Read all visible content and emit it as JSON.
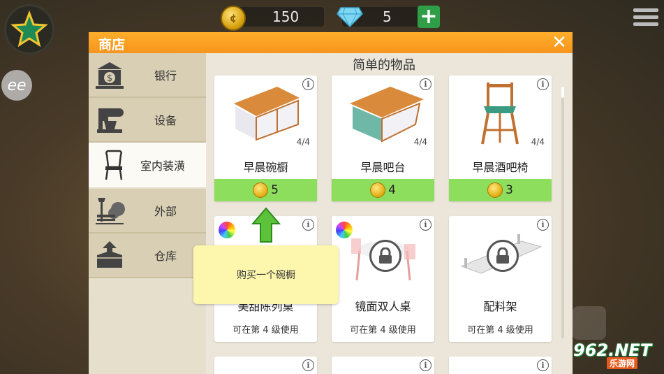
{
  "hud": {
    "coins": "150",
    "gems": "5",
    "plus": "+"
  },
  "avatar_text": "ee",
  "shop": {
    "title": "商店",
    "close": "✕",
    "sidebar": [
      {
        "label": "银行",
        "icon": "bank-icon"
      },
      {
        "label": "设备",
        "icon": "mixer-icon"
      },
      {
        "label": "室内装潢",
        "icon": "chair-icon",
        "active": true
      },
      {
        "label": "外部",
        "icon": "lamp-bench-icon"
      },
      {
        "label": "仓库",
        "icon": "storage-box-icon"
      }
    ],
    "section_title": "简单的物品",
    "row1": [
      {
        "name": "早晨碗橱",
        "count": "4/4",
        "price": "5"
      },
      {
        "name": "早晨吧台",
        "count": "4/4",
        "price": "4"
      },
      {
        "name": "早晨酒吧椅",
        "count": "4/4",
        "price": "3"
      }
    ],
    "row2": [
      {
        "name": "美甜陈列桌",
        "requirement": "可在第 4 级使用"
      },
      {
        "name": "镜面双人桌",
        "requirement": "可在第 4 级使用"
      },
      {
        "name": "配料架",
        "requirement": "可在第 4 级使用"
      }
    ],
    "info_glyph": "i"
  },
  "tooltip": {
    "text": "购买一个碗橱"
  },
  "watermark": {
    "main": "962.NET",
    "sub": "乐游网"
  },
  "colors": {
    "header_orange": "#f7941d",
    "price_green": "#8ede5e",
    "tooltip_yellow": "#fdf7ae"
  }
}
